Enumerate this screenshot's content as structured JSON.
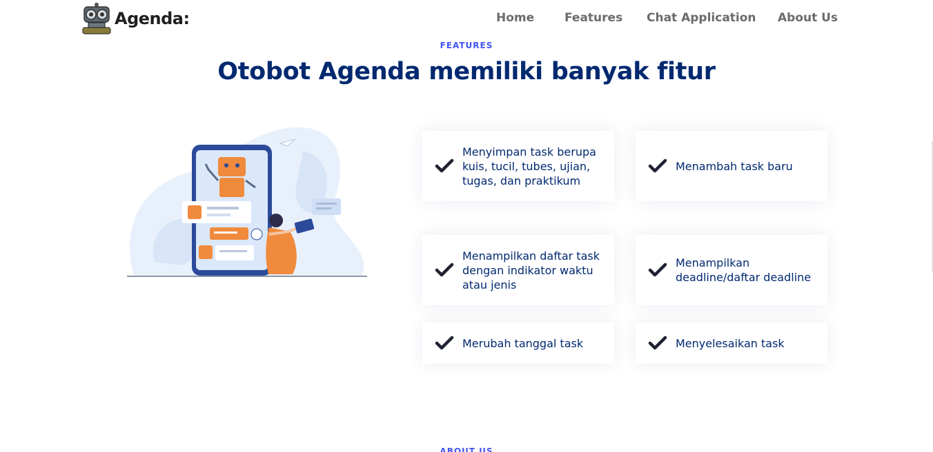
{
  "header": {
    "logo_text": "Agenda:",
    "nav": [
      {
        "label": "Home"
      },
      {
        "label": "Features"
      },
      {
        "label": "Chat Application"
      },
      {
        "label": "About Us"
      }
    ]
  },
  "features": {
    "eyebrow": "FEATURES",
    "title": "Otobot Agenda memiliki banyak fitur",
    "items": [
      {
        "text": "Menyimpan task berupa kuis, tucil, tubes, ujian, tugas, dan praktikum",
        "icon": "check-icon"
      },
      {
        "text": "Menambah task baru",
        "icon": "check-icon"
      },
      {
        "text": "Menampilkan daftar task dengan indikator waktu atau jenis",
        "icon": "check-icon"
      },
      {
        "text": "Menampilkan deadline/daftar deadline",
        "icon": "check-icon"
      },
      {
        "text": "Merubah tanggal task",
        "icon": "check-icon"
      },
      {
        "text": "Menyelesaikan task",
        "icon": "check-icon"
      }
    ]
  },
  "next_section": {
    "eyebrow": "ABOUT US"
  },
  "colors": {
    "accent": "#4154f1",
    "heading": "#012970",
    "nav": "#6b6b6b",
    "illustration_orange": "#f08a3c",
    "illustration_blue": "#2c4a9a"
  }
}
